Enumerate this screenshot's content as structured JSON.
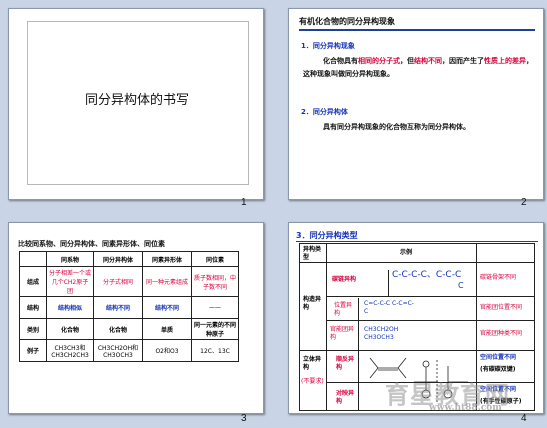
{
  "slides": [
    {
      "number": "1",
      "title": "同分异构体的书写"
    },
    {
      "number": "2",
      "heading": "有机化合物的同分异构现象",
      "section1": "1．同分异构现象",
      "para1_a": "化合物具有",
      "para1_b": "相同的分子式",
      "para1_c": "，但",
      "para1_d": "结构不同",
      "para1_e": "，因而产生了",
      "para1_f": "性质上的差异",
      "para1_g": "，这种现象叫做同分异构现象。",
      "section2": "2．同分异构体",
      "para2": "具有同分异构现象的化合物互称为同分异构体。"
    },
    {
      "number": "3",
      "heading": "比较同系物、同分异构体、同素异形体、同位素",
      "columns": [
        "",
        "同系物",
        "同分异构体",
        "同素异形体",
        "同位素"
      ],
      "rows": [
        [
          "组成",
          "分子相差一个或几个CH2原子团",
          "分子式相同",
          "同一种元素组成",
          "质子数相同，中子数不同"
        ],
        [
          "结构",
          "结构相似",
          "结构不同",
          "结构不同",
          "——"
        ],
        [
          "类别",
          "化合物",
          "化合物",
          "单质",
          "同一元素的不同种原子"
        ],
        [
          "例子",
          "CH3CH3和CH3CH2CH3",
          "CH3CH2OH和CH3OCH3",
          "O2和O3",
          "12C、13C"
        ]
      ]
    },
    {
      "number": "4",
      "heading": "3．同分异构类型",
      "col_type": "异构类型",
      "col_example": "示例",
      "structural": "构造异构",
      "chain": "碳链异构",
      "chain_formula1": "C-C-C-C、C-C-C",
      "chain_branch": "C",
      "chain_note": "碳链骨架不同",
      "position": "位置异构",
      "position_formula": "C=C-C-C  C-C=C-C",
      "position_note": "官能团位置不同",
      "functional": "官能团异构",
      "functional_formula": "CH3CH2OH  CH3OCH3",
      "functional_note": "官能团种类不同",
      "stereo": "立体异构",
      "stereo_note": "(不要求)",
      "cistrans": "顺反异构",
      "cistrans_note": "空间位置不同",
      "cistrans_note2": "(有碳碳双键)",
      "mirror": "对映异构",
      "mirror_note": "空间位置不同",
      "mirror_note2": "(有手性碳原子)",
      "watermark": "育星教育网",
      "watermark_url": "www.ht88.com"
    }
  ]
}
